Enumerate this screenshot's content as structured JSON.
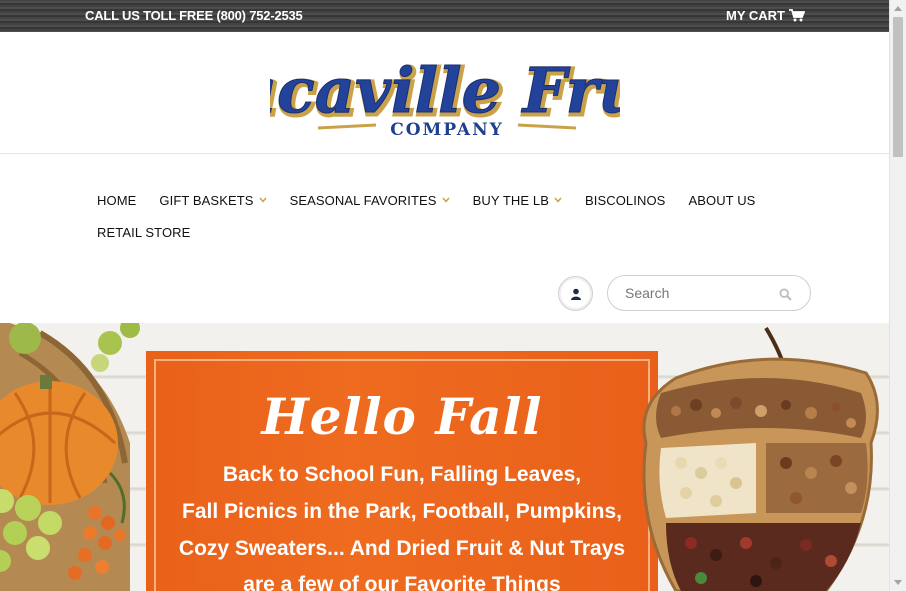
{
  "topbar": {
    "phone": "CALL US TOLL FREE (800) 752-2535",
    "cart_label": "MY CART"
  },
  "logo": {
    "line1": "Vacaville Fruit",
    "line2": "COMPANY"
  },
  "nav": {
    "row1": [
      {
        "label": "HOME",
        "dropdown": false
      },
      {
        "label": "GIFT BASKETS",
        "dropdown": true
      },
      {
        "label": "SEASONAL FAVORITES",
        "dropdown": true
      },
      {
        "label": "BUY THE LB",
        "dropdown": true
      },
      {
        "label": "BISCOLINOS",
        "dropdown": false
      },
      {
        "label": "ABOUT US",
        "dropdown": false
      }
    ],
    "row2": [
      {
        "label": "RETAIL STORE",
        "dropdown": false
      }
    ]
  },
  "search": {
    "placeholder": "Search"
  },
  "banner": {
    "heading": "Hello Fall",
    "line1": "Back to School Fun, Falling Leaves,",
    "line2": "Fall Picnics in the Park, Football, Pumpkins,",
    "line3": "Cozy Sweaters... And Dried Fruit & Nut Trays",
    "line4": "are a few of our Favorite Things"
  },
  "colors": {
    "accent_orange": "#e9611a",
    "logo_blue": "#1f3f8f",
    "logo_gold": "#c9a24a",
    "chevron": "#c9a24a"
  }
}
